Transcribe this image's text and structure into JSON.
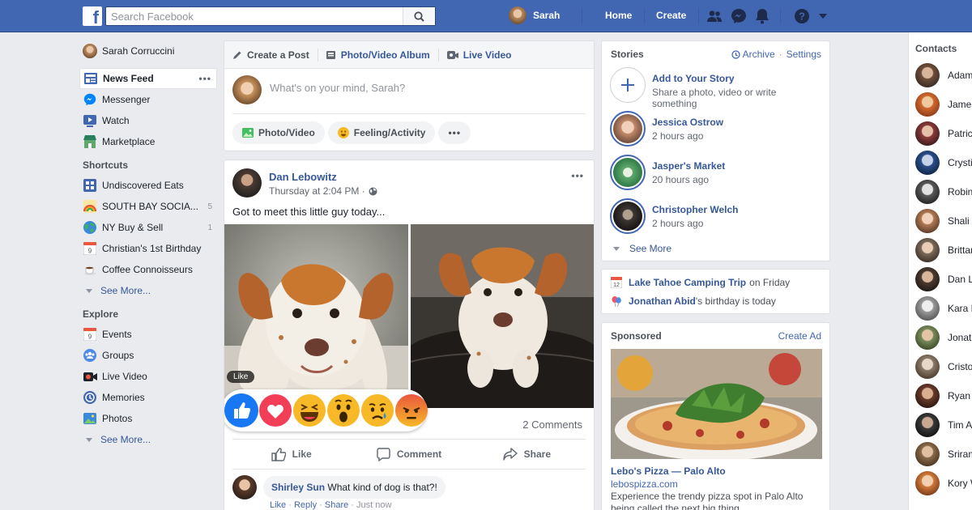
{
  "topbar": {
    "logo": "f",
    "search_placeholder": "Search Facebook",
    "user_name": "Sarah",
    "links": [
      "Home",
      "Create"
    ],
    "icons": [
      "friends-icon",
      "messenger-icon",
      "notifications-icon",
      "help-icon",
      "menu-caret-icon"
    ],
    "brand_color": "#4267b2"
  },
  "leftnav": {
    "profile_name": "Sarah Corruccini",
    "main": [
      {
        "label": "News Feed",
        "icon": "news-feed-icon",
        "more": "•••"
      },
      {
        "label": "Messenger",
        "icon": "messenger-icon"
      },
      {
        "label": "Watch",
        "icon": "watch-icon"
      },
      {
        "label": "Marketplace",
        "icon": "marketplace-icon"
      }
    ],
    "shortcuts_heading": "Shortcuts",
    "shortcuts": [
      {
        "label": "Undiscovered Eats",
        "icon": "calendar-grid-icon",
        "count": ""
      },
      {
        "label": "SOUTH BAY SOCIA...",
        "icon": "rainbow-icon",
        "count": "5"
      },
      {
        "label": "NY Buy & Sell",
        "icon": "globe-icon",
        "count": "1"
      },
      {
        "label": "Christian's 1st Birthday",
        "icon": "calendar-icon",
        "count": ""
      },
      {
        "label": "Coffee Connoisseurs",
        "icon": "coffee-icon",
        "count": ""
      }
    ],
    "shortcuts_see_more": "See More...",
    "explore_heading": "Explore",
    "explore": [
      {
        "label": "Events",
        "icon": "events-icon"
      },
      {
        "label": "Groups",
        "icon": "groups-icon"
      },
      {
        "label": "Live Video",
        "icon": "live-video-icon"
      },
      {
        "label": "Memories",
        "icon": "memories-icon"
      },
      {
        "label": "Photos",
        "icon": "photos-icon"
      }
    ],
    "explore_see_more": "See More..."
  },
  "composer": {
    "tabs": [
      {
        "label": "Create a Post",
        "icon": "pencil-icon"
      },
      {
        "label": "Photo/Video Album",
        "icon": "album-icon"
      },
      {
        "label": "Live Video",
        "icon": "live-video-icon"
      }
    ],
    "placeholder": "What's on your mind, Sarah?",
    "actions": [
      {
        "label": "Photo/Video",
        "icon": "photo-icon"
      },
      {
        "label": "Feeling/Activity",
        "icon": "smiley-icon"
      },
      {
        "label": "•••",
        "icon": ""
      }
    ]
  },
  "post": {
    "author": "Dan Lebowitz",
    "time": "Thursday at 2:04 PM ·",
    "more": "•••",
    "text": "Got to meet this little guy today...",
    "like_tooltip": "Like",
    "reactions": [
      "like",
      "love",
      "haha",
      "wow",
      "sad",
      "angry"
    ],
    "comments_count": "2 Comments",
    "actions": [
      "Like",
      "Comment",
      "Share"
    ],
    "comment": {
      "author": "Shirley Sun",
      "text": "What kind of dog is that?!",
      "meta_like": "Like",
      "meta_reply": "Reply",
      "meta_share": "Share",
      "meta_time": "Just now"
    }
  },
  "stories": {
    "title": "Stories",
    "archive": "Archive",
    "settings": "Settings",
    "add_title": "Add to Your Story",
    "add_sub": "Share a photo, video or write something",
    "items": [
      {
        "name": "Jessica Ostrow",
        "time": "2 hours ago"
      },
      {
        "name": "Jasper's Market",
        "time": "20 hours ago"
      },
      {
        "name": "Christopher Welch",
        "time": "2 hours ago"
      }
    ],
    "see_more": "See More"
  },
  "events": {
    "event_name": "Lake Tahoe Camping Trip",
    "event_when": "on Friday",
    "birthday_name": "Jonathan Abid",
    "birthday_text": "'s birthday is today",
    "calendar_day": "12"
  },
  "sponsored": {
    "title": "Sponsored",
    "create_ad": "Create Ad",
    "ad_title": "Lebo's Pizza — Palo Alto",
    "ad_url": "lebospizza.com",
    "ad_desc": "Experience the trendy pizza spot in Palo Alto being called the next big thing."
  },
  "contacts": {
    "title": "Contacts",
    "names": [
      "Adam",
      "James",
      "Patrick",
      "Crystin",
      "Robin",
      "Shali",
      "Brittan",
      "Dan L",
      "Kara P",
      "Jonath",
      "Cristol",
      "Ryan",
      "Tim A",
      "Sriram",
      "Kory W"
    ]
  }
}
